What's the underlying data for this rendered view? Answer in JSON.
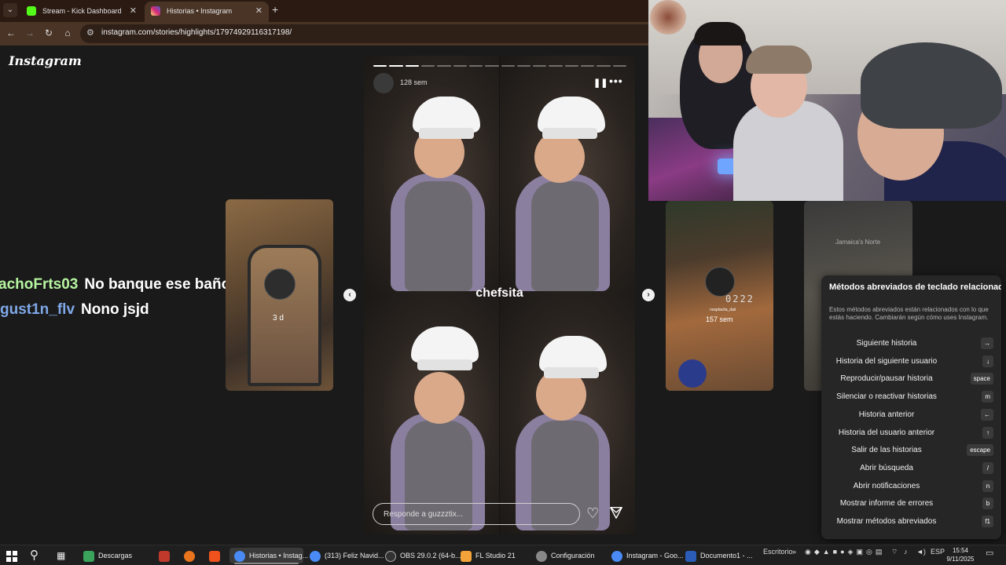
{
  "browser": {
    "tabs": [
      {
        "title": "Stream - Kick Dashboard",
        "favicon_color": "#53fc18"
      },
      {
        "title": "Historias • Instagram",
        "favicon_color": "#d62976"
      }
    ],
    "url": "instagram.com/stories/highlights/17974929116317198/"
  },
  "instagram": {
    "logo": "Instagram",
    "story": {
      "time_ago": "128 sem",
      "caption": "chefsita",
      "reply_placeholder": "Responde a guzzztix...",
      "segments": 16,
      "segments_done": 3
    },
    "left_card": {
      "age": "3 d"
    },
    "right_card": {
      "age": "157 sem",
      "timer": "0222",
      "username": "nosplacita_daii"
    },
    "far_right_card": {
      "place": "Jamaica's Norte"
    }
  },
  "chat": [
    {
      "user": "achoFrts03",
      "message": "No banque ese baño"
    },
    {
      "user": "gust1n_flv",
      "message": "Nono jsjd"
    }
  ],
  "shortcuts": {
    "title": "Métodos abreviados de teclado relacionados",
    "description": "Estos métodos abreviados están relacionados con lo que estás haciendo. Cambiarán según cómo uses Instagram.",
    "items": [
      {
        "label": "Siguiente historia",
        "key": "→"
      },
      {
        "label": "Historia del siguiente usuario",
        "key": "↓"
      },
      {
        "label": "Reproducir/pausar historia",
        "key": "space"
      },
      {
        "label": "Silenciar o reactivar historias",
        "key": "m"
      },
      {
        "label": "Historia anterior",
        "key": "←"
      },
      {
        "label": "Historia del usuario anterior",
        "key": "↑"
      },
      {
        "label": "Salir de las historias",
        "key": "escape"
      },
      {
        "label": "Abrir búsqueda",
        "key": "/"
      },
      {
        "label": "Abrir notificaciones",
        "key": "n"
      },
      {
        "label": "Mostrar informe de errores",
        "key": "b"
      },
      {
        "label": "Mostrar métodos abreviados",
        "key": "f1"
      }
    ]
  },
  "taskbar": {
    "items": [
      {
        "label": "Descargas",
        "color": "#3aa35c"
      },
      {
        "label": "Historias • Instag...",
        "color": "#4a8af4"
      },
      {
        "label": "(313) Feliz Navid...",
        "color": "#4a8af4"
      },
      {
        "label": "OBS 29.0.2 (64-b...",
        "color": "#444444"
      },
      {
        "label": "FL Studio 21",
        "color": "#f2a33a"
      },
      {
        "label": "Configuración",
        "color": "#888888"
      },
      {
        "label": "Instagram - Goo...",
        "color": "#4a8af4"
      },
      {
        "label": "Documento1 - ...",
        "color": "#2b5cb8"
      }
    ],
    "desktop_label": "Escritorio",
    "language": "ESP",
    "time": "15:54",
    "date": "9/11/2025"
  }
}
